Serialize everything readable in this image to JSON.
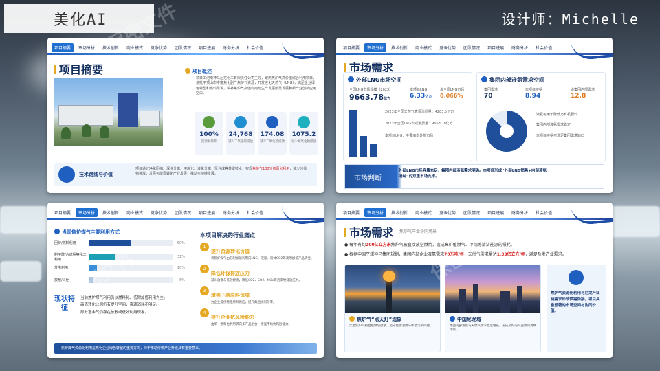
{
  "header": {
    "brand_label": "美化AI",
    "designer": "设计师：Michelle"
  },
  "nav_slide1": [
    "项目摘要",
    "市场分析",
    "技术创新",
    "商业模式",
    "竞争优势",
    "团队情况",
    "项目进展",
    "财务分析",
    "社会价值"
  ],
  "nav_slide2": [
    "项目摘要",
    "市场分析",
    "技术创新",
    "商业模式",
    "竞争优势",
    "团队情况",
    "项目进展",
    "财务分析",
    "社会价值"
  ],
  "nav_slide3": [
    "项目摘要",
    "市场分析",
    "技术创新",
    "商业模式",
    "竞争优势",
    "团队情况",
    "项目进展",
    "财务分析",
    "社会价值"
  ],
  "nav_slide4": [
    "项目摘要",
    "市场分析",
    "技术创新",
    "商业模式",
    "竞争优势",
    "团队情况",
    "项目进展",
    "财务分析",
    "社会价值"
  ],
  "slide1": {
    "title": "项目摘要",
    "overview_label": "项目概述",
    "overview_text": "项目由河南神马尼龙化工有限责任公司主导，聚焦焦炉气高价值综合利用项目，依托平顶山市丰富焦化副产焦炉气资源，开发液化天然气（LNG），满足企业绿色转型和燃料需求，填补焦炉气高值利用与生产发展所需发展和新产业创新应用空白。",
    "stats": [
      {
        "value": "100%",
        "label": "资源利用率",
        "color": "#5a9b3c"
      },
      {
        "value": "24,768",
        "label": "减少二氧化碳排放",
        "color": "#1f8fd1"
      },
      {
        "value": "174.08",
        "label": "减少二氧化硫排放",
        "color": "#1f5fc0"
      },
      {
        "value": "1075.2",
        "label": "减少氮氧化物排放",
        "color": "#1fb0c0"
      }
    ],
    "footer_title": "技术路线与价值",
    "footer_text_a": "项目通过净化压缩、深冷分离、甲烷化、液化分离，氢合成等关键技术，实现",
    "footer_text_red": "焦炉气100%资源化利用",
    "footer_text_b": "，减少污染物排放，发展可能源转化产业发展，推动可持续发展。"
  },
  "slide2": {
    "title": "市场需求",
    "card1_title": "外部LNG市场空间",
    "card1_k1_label": "全国LNG市场规模（2023）",
    "card1_k1_value": "9663.78",
    "card1_k1_unit": "亿方",
    "card1_k2_label": "本项目LNG",
    "card1_k2_value": "6.33",
    "card1_k2_unit": "亿方",
    "card1_k3_label": "占全国LNG市场",
    "card1_k3_value": "0.066%",
    "card1_bars": [
      85,
      38,
      22
    ],
    "card1_notes": [
      "2023年全国天然气表观消费量：4283.5亿方",
      "2023年全国LNG表观消费量：9663.78亿方",
      "本项目LNG：主要面向外部市场"
    ],
    "card2_title": "集团内部液氨需求空间",
    "card2_k1_label": "集团需求",
    "card2_k1_value": "70",
    "card2_k2_label": "本项目液氨",
    "card2_k2_value": "8.94",
    "card2_k3_label": "占集团内部需求",
    "card2_k3_value": "12.8",
    "card2_pie_fraction": 0.87,
    "card2_notes": [
      "液氨可用于降低乃有机肥料",
      "集团内部液氨需求稳定",
      "本项目液氨可满足集团需求缺口"
    ],
    "banner_label": "市场判断",
    "banner_text": "外部LNG市场容量充足，集团内部液氨需求明确。本项目形成“外部LNG销售+内部液氨消纳”的双重市场支撑。"
  },
  "slide3": {
    "subtitle": "当前焦炉煤气主要利用方式",
    "bars": [
      {
        "label": "回炉/燃料利用",
        "pct": "50%",
        "value": 50,
        "color": "#1f4f9a"
      },
      {
        "label": "制甲醇/合成氨等化工利用",
        "pct": "31%",
        "value": 31,
        "color": "#1ba0b5"
      },
      {
        "label": "发电利用",
        "pct": "10%",
        "value": 10,
        "color": "#3b8fd8"
      },
      {
        "label": "放散/火炬",
        "pct": "5%",
        "value": 5,
        "color": "#9ab8d8"
      }
    ],
    "status_label": "现状特征",
    "status_points": [
      "当前焦炉煤气利用仍以燃料化、低附加值利用为主。",
      "高值转化比例仍有提升空间，资源消耗不够足。",
      "部分富余气仍存在放散或低效利用现象。"
    ],
    "issues_title": "本项目解决的行业痛点",
    "issues": [
      {
        "title": "提升资源转化价值",
        "desc": "将焦炉煤气由低附加值利用向LNG、液氨、液体CO2等高附加值产品转变。"
      },
      {
        "title": "降低环保排放压力",
        "desc": "减少放散与低效燃烧，降低CO2、SO2、NOx等污染物排放压力。"
      },
      {
        "title": "增强下游原料保障",
        "desc": "为企业提供稳定原料供应，提升集团协同效率。"
      },
      {
        "title": "提升企业抗风险能力",
        "desc": "由单一燃料化利用转向多产品组合，增强市场抗风险能力。"
      }
    ],
    "footer_text": "焦炉煤气资源化利用是焦化企业绿色转型的重要方向，对于推动传统产业升级具有重要意义。"
  },
  "slide4": {
    "title": "市场需求",
    "subtitle": "焦炉气产业协同场景",
    "point1_a": "每年有约",
    "point1_red": "200亿立方米",
    "point1_b": "焦炉气被直接放空燃烧，造成高价值燃气、甲烷等清洁能源的损耗。",
    "point2_a": "根据中国平煤神马集团规划，集团内部企业液氨需求",
    "point2_red": "70万吨/年",
    "point2_b": "，天然气需求量达",
    "point2_red2": "1.33亿立方/年",
    "point2_c": "，满足及发产业需求。",
    "card1_caption": "焦炉气“点天灯”现象",
    "card1_desc": "大量焦炉气被直接燃烧放散，造成能源浪费与环境污染问题。",
    "card2_caption": "中国尼龙城",
    "card2_desc": "集团内部液氨与天然气需求稳定增长，形成良好的产业协同消纳场景。",
    "side_text": "焦炉气资源化利用与尼龙产业链需求形成供需衔接，项目具备显著的市场空间与协同价值。"
  },
  "watermark": "保密文件"
}
